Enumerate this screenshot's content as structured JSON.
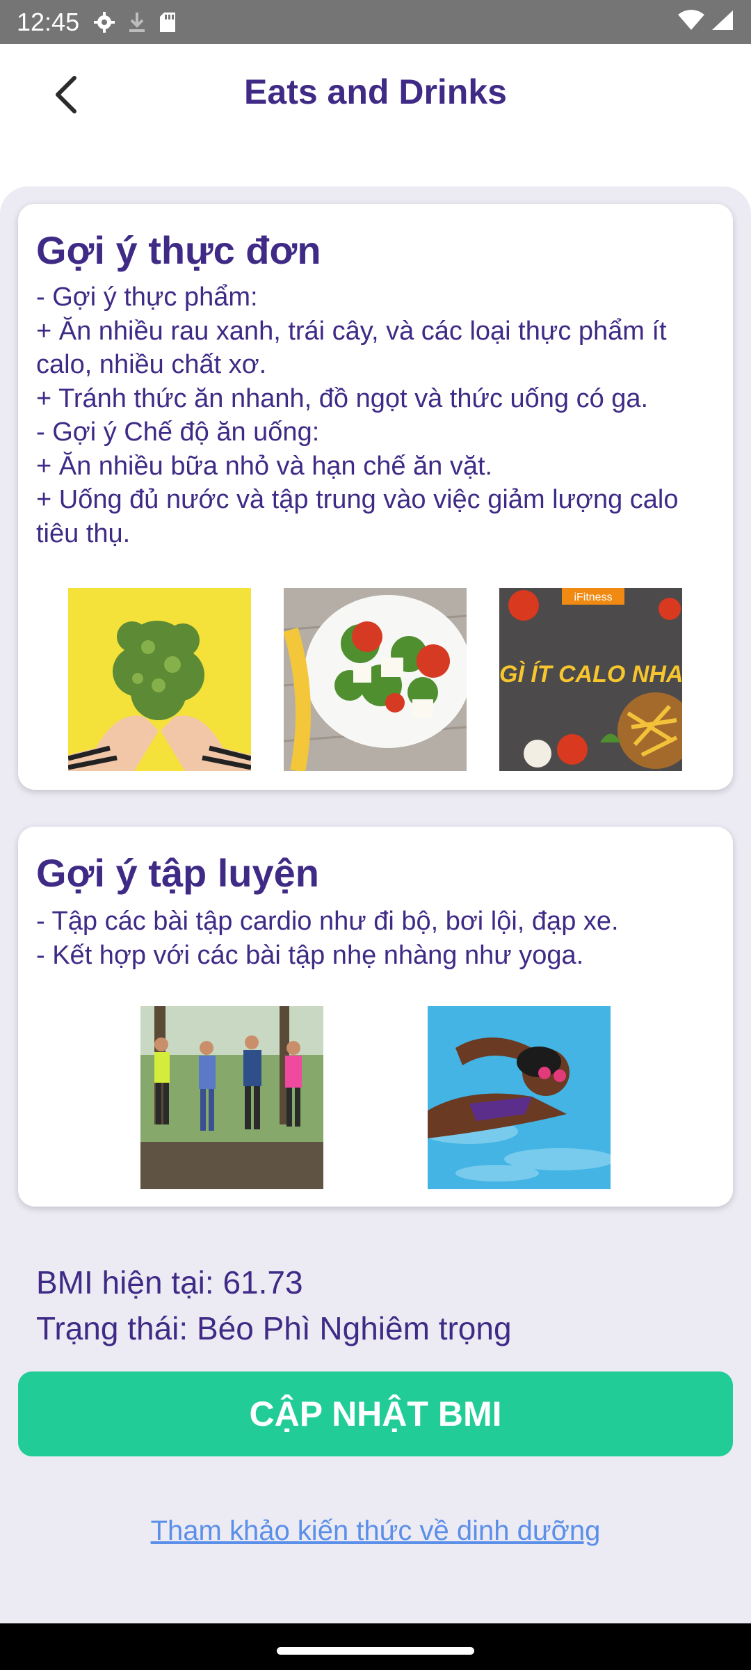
{
  "status_bar": {
    "time": "12:45",
    "icons": [
      "settings-icon",
      "download-icon",
      "sd-card-icon",
      "wifi-icon",
      "signal-icon"
    ]
  },
  "header": {
    "title": "Eats and Drinks",
    "back_icon": "chevron-left-icon"
  },
  "menu_card": {
    "title": "Gợi ý thực đơn",
    "body": "- Gợi ý thực phẩm:\n+ Ăn nhiều rau xanh, trái cây, và các loại thực phẩm ít calo, nhiều chất xơ.\n+ Tránh thức ăn nhanh, đồ ngọt và thức uống có ga.\n- Gợi ý Chế độ ăn uống:\n+ Ăn nhiều bữa nhỏ và hạn chế ăn vặt.\n+ Uống đủ nước và tập trung vào việc giảm lượng calo tiêu thụ.",
    "images": [
      "kale-image",
      "salad-image",
      "low-calorie-food-image"
    ],
    "image3_caption": "GÌ ÍT CALO NHA",
    "image3_brand": "iFitness"
  },
  "exercise_card": {
    "title": "Gợi ý tập luyện",
    "body": "- Tập các bài tập cardio như đi bộ, bơi lội, đạp xe.\n- Kết hợp với các bài tập nhẹ nhàng như yoga.",
    "images": [
      "running-group-image",
      "swimmer-image"
    ]
  },
  "bmi": {
    "current": "BMI hiện tại: 61.73",
    "status": "Trạng thái: Béo Phì Nghiêm trọng"
  },
  "actions": {
    "update_bmi": "CẬP NHẬT BMI",
    "reference_link": "Tham khảo kiến thức về dinh dưỡng"
  },
  "colors": {
    "primary_text": "#3f2a86",
    "button": "#21cc97",
    "link": "#5b8fe8",
    "background": "#ecebf4"
  }
}
